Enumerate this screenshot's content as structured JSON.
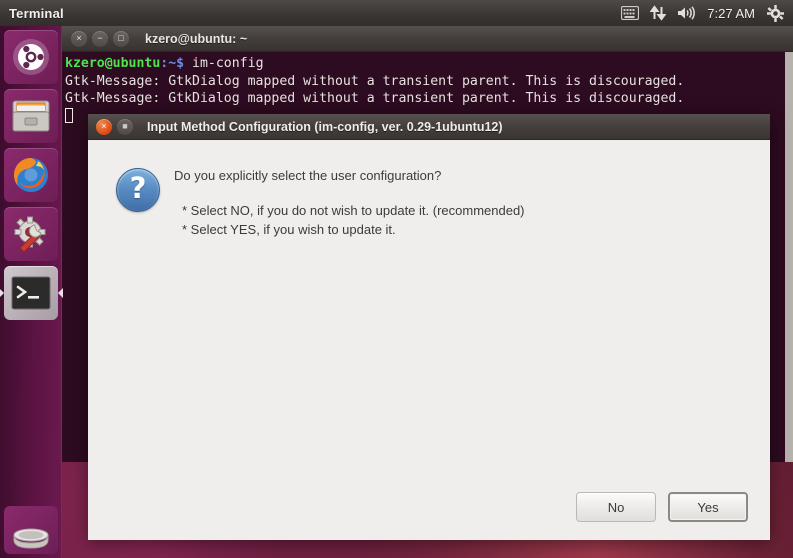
{
  "panel": {
    "title": "Terminal",
    "clock": "7:27 AM",
    "icons": [
      {
        "name": "keyboard-indicator-icon",
        "glyph": "keyboard"
      },
      {
        "name": "network-indicator-icon",
        "glyph": "up-down-arrows"
      },
      {
        "name": "volume-indicator-icon",
        "glyph": "speaker"
      },
      {
        "name": "session-menu-icon",
        "glyph": "gear"
      }
    ]
  },
  "launcher": {
    "items": [
      {
        "name": "dash-home",
        "icon": "ubuntu-logo-icon"
      },
      {
        "name": "files",
        "icon": "file-manager-icon"
      },
      {
        "name": "firefox",
        "icon": "firefox-icon"
      },
      {
        "name": "system-settings",
        "icon": "gear-wrench-icon"
      },
      {
        "name": "terminal",
        "icon": "terminal-icon",
        "active": true
      }
    ],
    "trash": {
      "name": "trash",
      "icon": "trash-icon"
    }
  },
  "terminal": {
    "title": "kzero@ubuntu: ~",
    "window_buttons": {
      "close": "×",
      "minimize": "−",
      "maximize": "□"
    },
    "lines": [
      {
        "prompt_user": "kzero@ubuntu",
        "prompt_path": ":~$",
        "command": " im-config"
      },
      {
        "output": "Gtk-Message: GtkDialog mapped without a transient parent. This is discouraged."
      },
      {
        "output": "Gtk-Message: GtkDialog mapped without a transient parent. This is discouraged."
      }
    ],
    "colors": {
      "background": "#2d0b20",
      "user": "#4ce64c",
      "path": "#6a8ee8",
      "text": "#e6e2de"
    }
  },
  "dialog": {
    "title": "Input Method Configuration (im-config, ver. 0.29-1ubuntu12)",
    "window_buttons": {
      "close": "×",
      "maximize": "■"
    },
    "icon": "question-mark-icon",
    "icon_glyph": "?",
    "question": "Do you explicitly select the user configuration?",
    "bullets": [
      "* Select NO, if you do not wish to update it. (recommended)",
      "* Select YES, if you wish to update it."
    ],
    "buttons": {
      "no_label": "No",
      "yes_label": "Yes",
      "focused": "Yes"
    }
  },
  "colors": {
    "panel": "#3c3836",
    "desktop_purple": "#5d1240",
    "ubuntu_orange": "#dd4814",
    "dialog_bg": "#f0eeec"
  }
}
